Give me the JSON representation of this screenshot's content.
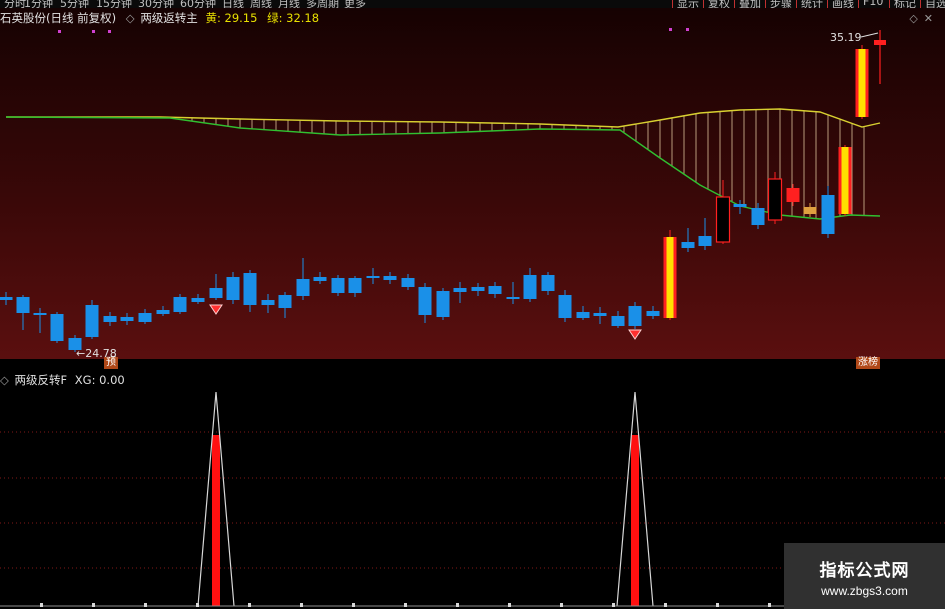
{
  "toolbar": {
    "periods": [
      "分时",
      "1分钟",
      "5分钟",
      "15分钟",
      "30分钟",
      "60分钟",
      "日线",
      "周线",
      "月线",
      "多周期",
      "更多"
    ],
    "buttons": [
      "显示",
      "复权",
      "叠加",
      "步骤",
      "统计",
      "画线",
      "F10",
      "标记",
      "自选"
    ]
  },
  "main_panel": {
    "stock_name": "石英股份(日线 前复权)",
    "indicator_name": "两级返转主",
    "yellow_label": "黄:",
    "yellow_value": "29.15",
    "green_label": "绿:",
    "green_value": "32.18",
    "high_marker": "35.19",
    "low_marker": "24.78",
    "tag_left": "预",
    "tag_right": "涨榜",
    "colors": {
      "up_candle": "#ff2020",
      "down_candle": "#1a90e8",
      "yellow_line": "#d8d030",
      "green_line": "#30c030",
      "signal_bar": "#ffe000",
      "signal_bar_border": "#ff2020"
    }
  },
  "sub_panel": {
    "indicator_name": "两级反转F",
    "xg_text": "XG: 0.00"
  },
  "watermark": {
    "name": "指标公式网",
    "url": "www.zbgs3.com"
  }
}
